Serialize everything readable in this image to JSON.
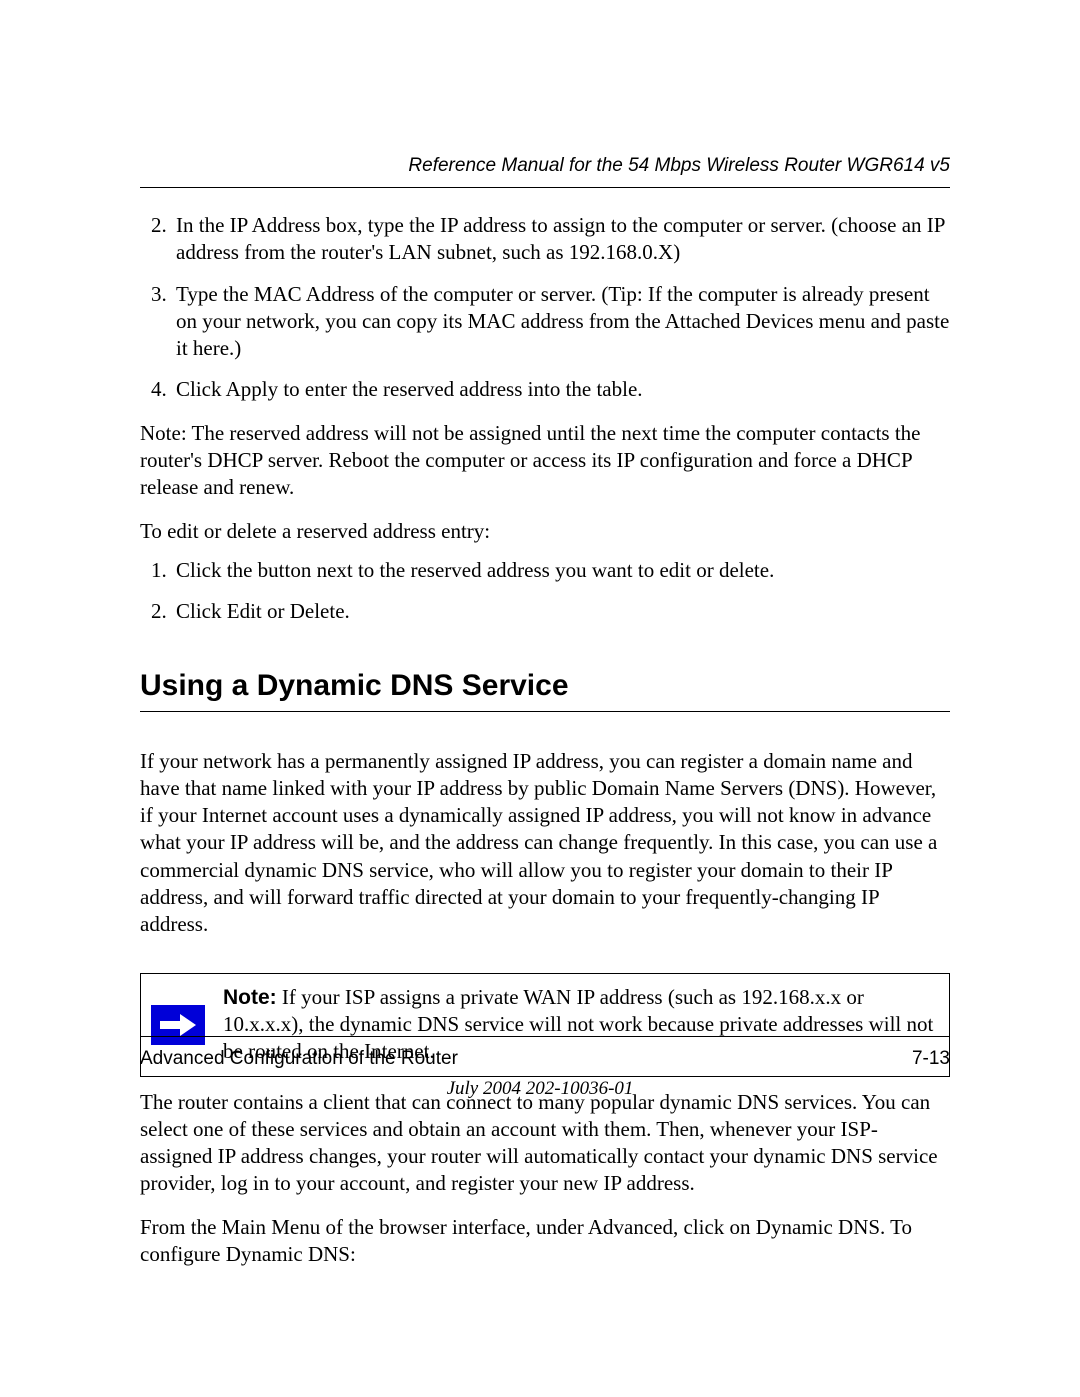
{
  "header": {
    "title": "Reference Manual for the 54 Mbps Wireless Router WGR614 v5"
  },
  "list1": {
    "start": 2,
    "items": [
      "In the IP Address box, type the IP address to assign to the computer or server. (choose an IP address from the router's LAN subnet, such as 192.168.0.X)",
      "Type the MAC Address of the computer or server.\n(Tip: If the computer is already present on your network, you can copy its MAC address from the Attached Devices menu and paste it here.)",
      "Click Apply to enter the reserved address into the table."
    ]
  },
  "para1": "Note: The reserved address will not be assigned until the next time the computer contacts the router's DHCP server. Reboot the computer or access its IP configuration and force a DHCP release and renew.",
  "para2": "To edit or delete a reserved address entry:",
  "list2": {
    "start": 1,
    "items": [
      "Click the button next to the reserved address you want to edit or delete.",
      "Click Edit or Delete."
    ]
  },
  "section_heading": "Using a Dynamic DNS Service",
  "para3": "If your network has a permanently assigned IP address, you can register a domain name and have that name linked with your IP address by public Domain Name Servers (DNS). However, if your Internet account uses a dynamically assigned IP address, you will not know in advance what your IP address will be, and the address can change frequently. In this case, you can use a commercial dynamic DNS service, who will allow you to register your domain to their IP address, and will forward traffic directed at your domain to your frequently-changing IP address.",
  "note": {
    "label": "Note:",
    "text": " If your ISP assigns a private WAN IP address (such as 192.168.x.x or 10.x.x.x), the dynamic DNS service will not work because private addresses will not be routed on the Internet."
  },
  "para4": "The router contains a client that can connect to many popular dynamic DNS services. You can select one of these services and obtain an account with them. Then, whenever your ISP-assigned IP address changes, your router will automatically contact your dynamic DNS service provider, log in to your account, and register your new IP address.",
  "para5": "From the Main Menu of the browser interface, under Advanced, click on Dynamic DNS. To configure Dynamic DNS:",
  "footer": {
    "left": "Advanced Configuration of the Router",
    "right": "7-13",
    "center": "July 2004 202-10036-01"
  }
}
